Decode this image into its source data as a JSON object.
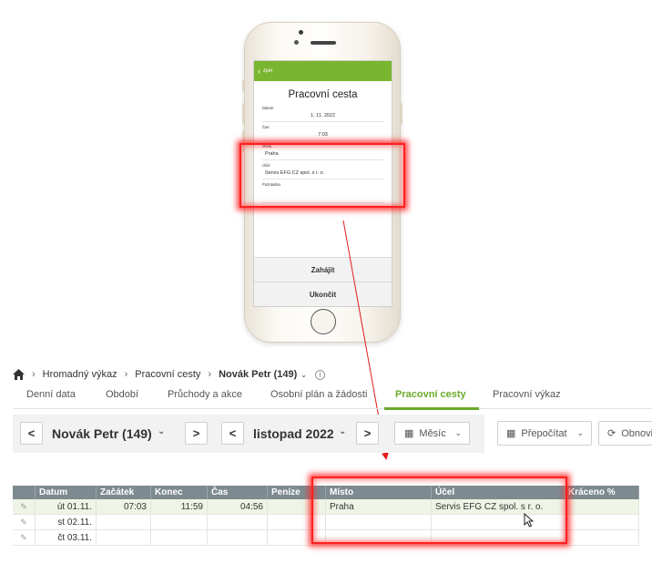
{
  "phone": {
    "back_label": "Zpět",
    "title": "Pracovní cesta",
    "fields": [
      {
        "label": "Datum",
        "value": "1. 11. 2022"
      },
      {
        "label": "Čas",
        "value": "7:03"
      },
      {
        "label": "Místo",
        "value": "Praha"
      },
      {
        "label": "Účel",
        "value": "Servis EFG CZ spol. s r. o."
      },
      {
        "label": "Poznámka",
        "value": ""
      }
    ],
    "buttons": {
      "start": "Zahájit",
      "end": "Ukončit"
    }
  },
  "breadcrumb": {
    "items": [
      "Hromadný výkaz",
      "Pracovní cesty"
    ],
    "current": "Novák Petr (149)"
  },
  "tabs": [
    "Denní data",
    "Období",
    "Průchody a akce",
    "Osobní plán a žádosti",
    "Pracovní cesty",
    "Pracovní výkaz"
  ],
  "active_tab": "Pracovní cesty",
  "toolbar": {
    "prev": "<",
    "next": ">",
    "employee": "Novák Petr (149)",
    "period": "listopad 2022",
    "view": "Měsíc",
    "recalc": "Přepočítat",
    "refresh": "Obnovit"
  },
  "table": {
    "columns": [
      "",
      "Datum",
      "Začátek",
      "Konec",
      "Čas",
      "Peníze",
      "",
      "Místo",
      "Účel",
      "Kráceno %"
    ],
    "rows": [
      [
        "",
        "út 01.11.",
        "07:03",
        "11:59",
        "04:56",
        "",
        "",
        "Praha",
        "Servis EFG CZ spol. s r. o.",
        ""
      ],
      [
        "",
        "st 02.11.",
        "",
        "",
        "",
        "",
        "",
        "",
        "",
        ""
      ],
      [
        "",
        "čt 03.11.",
        "",
        "",
        "",
        "",
        "",
        "",
        "",
        ""
      ]
    ]
  },
  "colors": {
    "accent": "#6aaa2a",
    "phone_bar": "#7ab530",
    "highlight": "#ff2020",
    "table_header": "#7d8a90"
  }
}
